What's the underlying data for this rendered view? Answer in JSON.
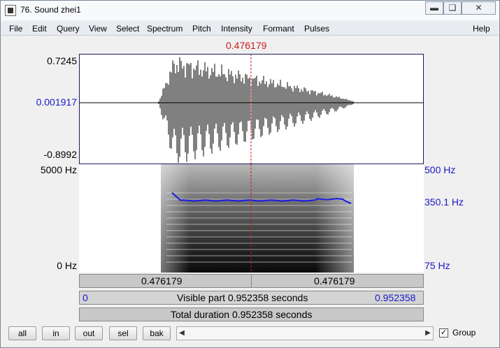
{
  "window": {
    "title": "76. Sound zhei1",
    "minimize_icon": "minimize-icon",
    "maximize_icon": "maximize-icon",
    "close_icon": "close-icon"
  },
  "menu": [
    "File",
    "Edit",
    "Query",
    "View",
    "Select",
    "Spectrum",
    "Pitch",
    "Intensity",
    "Formant",
    "Pulses"
  ],
  "help": "Help",
  "cursor_time": "0.476179",
  "waveform": {
    "ymax": "0.7245",
    "yzero": "0.001917",
    "ymin": "-0.8992"
  },
  "spectrogram": {
    "freq_max": "5000 Hz",
    "freq_min": "0 Hz",
    "pitch_max": "500 Hz",
    "pitch_value": "350.1 Hz",
    "pitch_min": "75 Hz",
    "pitch_color": "#1a1ae6"
  },
  "time_bar": {
    "left": "0.476179",
    "right": "0.476179"
  },
  "visible_bar": {
    "start": "0",
    "label": "Visible part 0.952358 seconds",
    "end": "0.952358"
  },
  "total_bar": {
    "label": "Total duration 0.952358 seconds"
  },
  "buttons": {
    "all": "all",
    "in": "in",
    "out": "out",
    "sel": "sel",
    "bak": "bak"
  },
  "group": {
    "label": "Group",
    "checked": true
  }
}
